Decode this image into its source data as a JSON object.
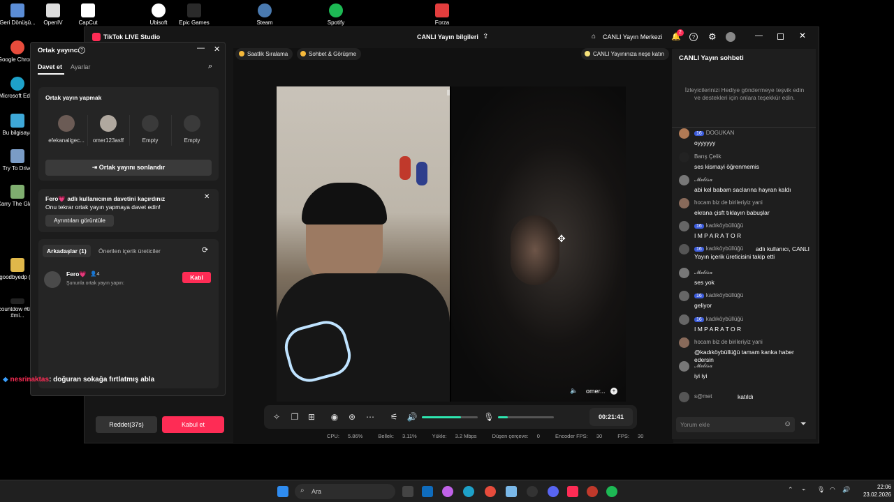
{
  "desktop": {
    "icons": [
      {
        "label": "Geri Dönüşü...",
        "color": "#5b8dd6"
      },
      {
        "label": "Google Chrome",
        "color": "#e74c3c"
      },
      {
        "label": "Microsoft Edge",
        "color": "#1ea1c9"
      },
      {
        "label": "Bu bilgisaya",
        "color": "#3ea8d8"
      },
      {
        "label": "Try To Drive",
        "color": "#7a9cc6"
      },
      {
        "label": "Carry The Glass",
        "color": "#7fae6f"
      },
      {
        "label": "goodbyedp (2)",
        "color": "#e0b84a"
      },
      {
        "label": "#countdow #timer #mi...",
        "color": "#222222"
      }
    ],
    "top_icons": [
      {
        "label": "OpenIV",
        "color": "#dddddd"
      },
      {
        "label": "CapCut",
        "color": "#ffffff"
      },
      {
        "label": "Ubisoft",
        "color": "#ffffff"
      },
      {
        "label": "Epic Games",
        "color": "#2a2a2a"
      },
      {
        "label": "Steam",
        "color": "#1b2838"
      },
      {
        "label": "Spotify",
        "color": "#1db954"
      },
      {
        "label": "Forza",
        "color": "#e23d3d"
      }
    ]
  },
  "window": {
    "app_title": "TikTok LIVE Studio",
    "center_title": "CANLI Yayın bilgileri",
    "live_center": "CANLI Yayın Merkezi",
    "notif_count": "2"
  },
  "stage": {
    "chips": [
      "Saatlik Sıralama",
      "Sohbet & Görüşme"
    ],
    "right_chip": "CANLI Yayınınıza neşe katın",
    "guest_name": "omer...",
    "timer": "00:21:41",
    "volume_level": 0.7,
    "mic_level": 0.18
  },
  "status": {
    "cpu_label": "CPU:",
    "cpu": "5.86%",
    "mem_label": "Bellek:",
    "mem": "3.11%",
    "up_label": "Yükle:",
    "up": "3.2 Mbps",
    "drop_label": "Düşen çerçeve:",
    "drop": "0",
    "efps_label": "Encoder FPS:",
    "efps": "30",
    "fps_label": "FPS:",
    "fps": "30"
  },
  "chat": {
    "title": "CANLI Yayın sohbeti",
    "hint": "İzleyicilerinizi Hediye göndermeye teşvik edin ve destekleri için onlara teşekkür edin.",
    "messages": [
      {
        "badge": "16",
        "name": "DOGUKAN",
        "text": "oyyyyyy"
      },
      {
        "badge": "",
        "name": "Barış Çelik",
        "text": "ses kismayi öğrenmemis"
      },
      {
        "badge": "",
        "name": "𝓜𝓮𝓵𝓲𝓼𝓪",
        "text": "abi kel babam saclarına hayran kaldı"
      },
      {
        "badge": "",
        "name": "hocam biz de birileriyiz yani",
        "text": "ekrana çisft tıklayın babuşlar"
      },
      {
        "badge": "16",
        "name": "kadıköybüllüğü",
        "text": "I M P A R A T O R"
      },
      {
        "badge": "16",
        "name": "kadıköybüllüğü",
        "text": "adlı kullanıcı, CANLI Yayın içerik üreticisini takip etti"
      },
      {
        "badge": "",
        "name": "𝓜𝓮𝓵𝓲𝓼𝓪",
        "text": "ses yok"
      },
      {
        "badge": "16",
        "name": "kadıköybüllüğü",
        "text": "geliyor"
      },
      {
        "badge": "16",
        "name": "kadıköybüllüğü",
        "text": "I M P A R A T O R"
      },
      {
        "badge": "",
        "name": "hocam biz de birileriyiz yani",
        "text": "@kadıköybüllüğü tamam kanka haber edersin"
      },
      {
        "badge": "",
        "name": "𝓜𝓮𝓵𝓲𝓼𝓪",
        "text": "iyi iyi"
      },
      {
        "badge": "",
        "name": "s@met",
        "text": "katıldı"
      }
    ],
    "input_placeholder": "Yorum ekle"
  },
  "popup": {
    "title": "Ortak yayıncı",
    "tabs": [
      "Davet et",
      "Ayarlar"
    ],
    "section_title": "Ortak yayın yapmak",
    "slots": [
      "efekanaligec...",
      "omer123asff",
      "Empty",
      "Empty"
    ],
    "end_button": "Ortak yayını sonlandır",
    "missed_title": "Fero💗 adlı kullanıcının davetini kaçırdınız",
    "missed_sub": "Onu tekrar ortak yayın yapmaya davet edin!",
    "details_button": "Ayrıntıları görüntüle",
    "friends_tab": "Arkadaşlar (1)",
    "suggest_tab": "Önerilen içerik üreticiler",
    "friend_name": "Fero💗",
    "friend_count": "4",
    "friend_sub": "Şununla ortak yayın yapın:",
    "join_button": "Katıl"
  },
  "overlay_comment": {
    "user": "nesrinaktas",
    "text": ": doğuran sokağa fırtlatmış abla"
  },
  "bottom_buttons": {
    "decline": "Reddet(37s)",
    "accept": "Kabul et"
  },
  "taskbar": {
    "search": "Ara",
    "time": "22:06",
    "date": "23.02.2026"
  }
}
